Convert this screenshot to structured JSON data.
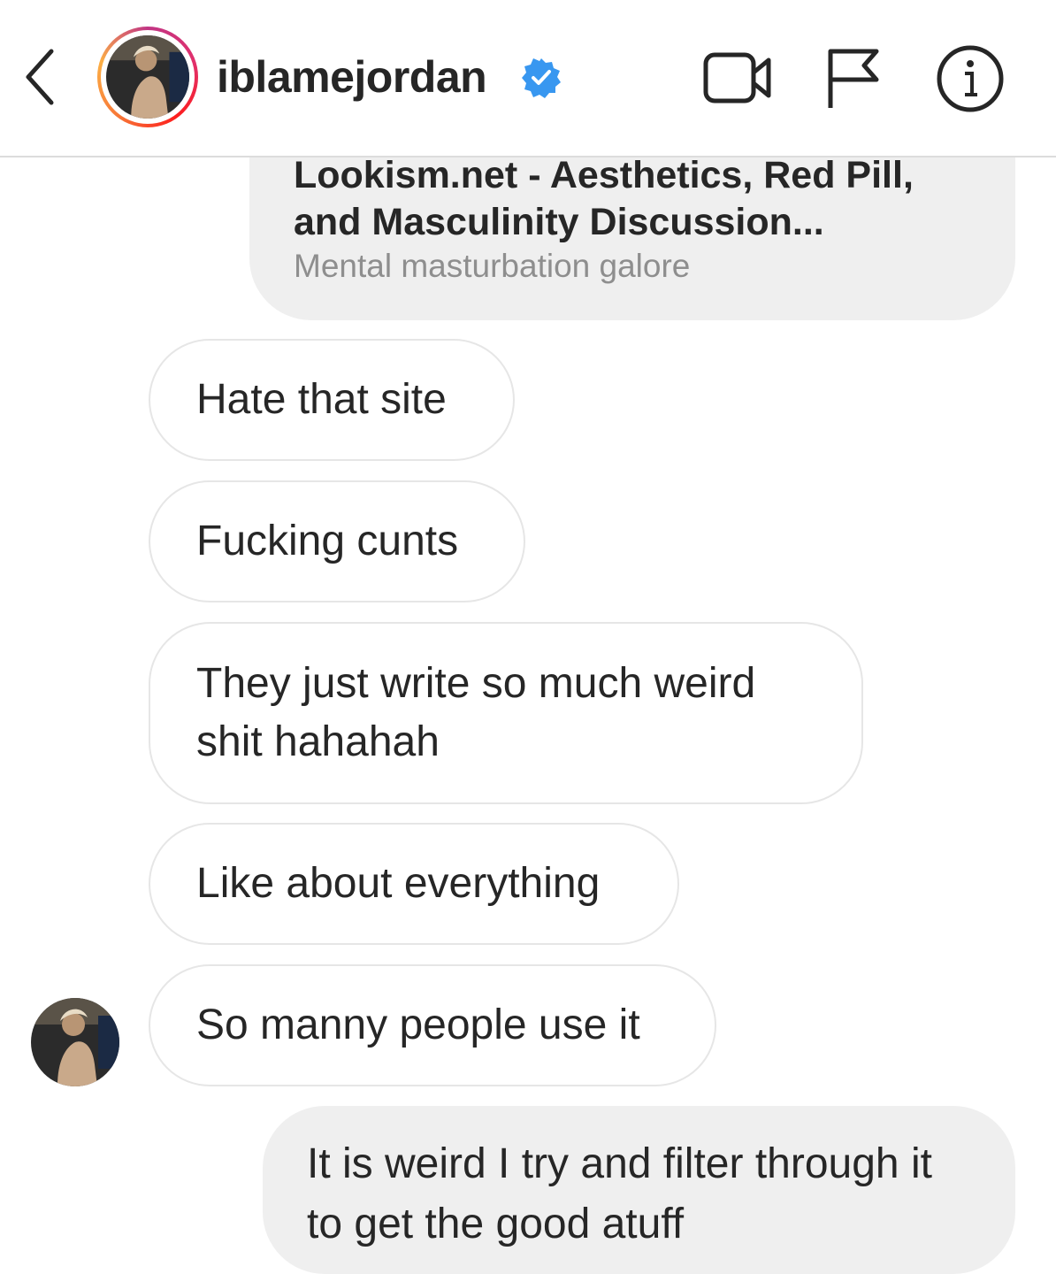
{
  "header": {
    "username": "iblamejordan",
    "verified": true,
    "back_icon": "chevron-left-icon",
    "actions": [
      "video-call-icon",
      "flag-icon",
      "info-icon"
    ]
  },
  "link_preview": {
    "title": "Lookism.net - Aesthetics, Red Pill, and Masculinity Discussion...",
    "subtitle": "Mental masturbation galore"
  },
  "messages": [
    {
      "sender": "them",
      "text": "Hate that site"
    },
    {
      "sender": "them",
      "text": "Fucking cunts"
    },
    {
      "sender": "them",
      "text": "They just write so much weird shit hahahah"
    },
    {
      "sender": "them",
      "text": "Like about everything"
    },
    {
      "sender": "them",
      "text": "So manny people use it"
    },
    {
      "sender": "me",
      "text": "It is weird I try and filter through it to get the good atuff"
    }
  ],
  "colors": {
    "sent_bubble": "#efefef",
    "received_border": "#e6e6e6",
    "verified_badge": "#3897f0",
    "text": "#262626",
    "muted_text": "#8e8e8e"
  }
}
